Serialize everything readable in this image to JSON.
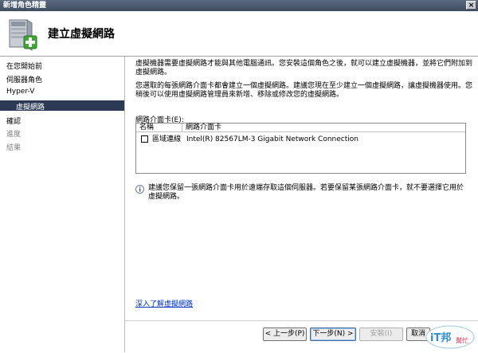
{
  "window": {
    "title": "新增角色精靈",
    "close_label": "×"
  },
  "header": {
    "title": "建立虛擬網路"
  },
  "sidebar": {
    "items": [
      {
        "label": "在您開始前"
      },
      {
        "label": "伺服器角色"
      },
      {
        "label": "Hyper-V"
      },
      {
        "label": "虛擬網路"
      },
      {
        "label": "確認"
      },
      {
        "label": "進度"
      },
      {
        "label": "結果"
      }
    ]
  },
  "main": {
    "intro_text": "虛擬機器需要虛擬網路才能與其他電腦通訊。您安裝這個角色之後，就可以建立虛擬機器，並將它們附加到虛擬網路。",
    "detail_text": "您選取的每張網路介面卡都會建立一個虛擬網路。建議您現在至少建立一個虛擬網路，讓虛擬機器使用。您稍後可以使用虛擬網路管理員來新增、移除或修改您的虛擬網路。",
    "adapters_label": "網路介面卡(E):",
    "columns": [
      "名稱",
      "網路介面卡"
    ],
    "adapters": [
      {
        "name": "區域連線",
        "adapter": "Intel(R) 82567LM-3 Gigabit Network Connection",
        "checked": false
      }
    ],
    "info_text": "建議您保留一張網路介面卡用於遠端存取這個伺服器。若要保留某張網路介面卡，就不要選擇它用於虛擬網路。",
    "learn_more_link": "深入了解虛擬網路"
  },
  "buttons": {
    "back": "< 上一步(P)",
    "next": "下一步(N) >",
    "install": "安裝(I)",
    "cancel": "取消"
  },
  "watermark": {
    "text_main": "iT邦",
    "text_sub": "幫忙"
  }
}
